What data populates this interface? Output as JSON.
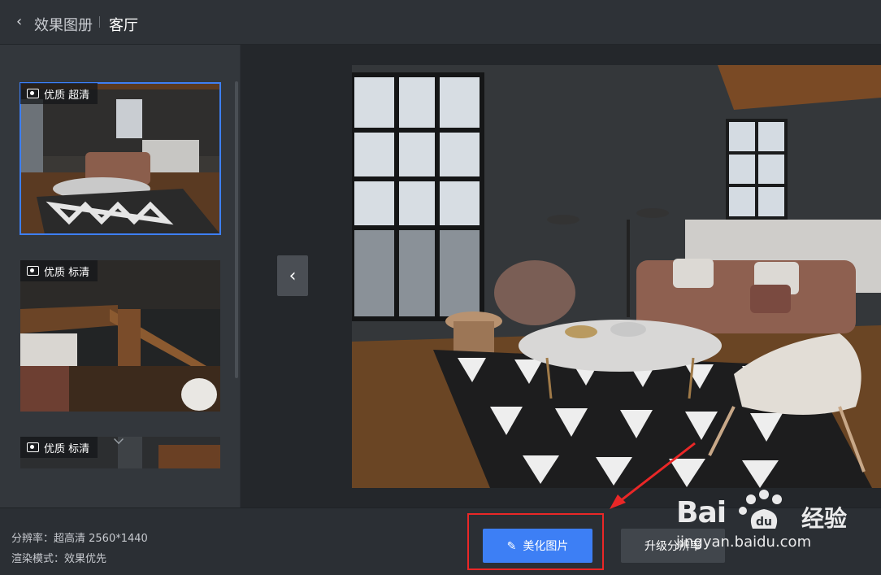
{
  "header": {
    "back_icon": "chevron-left-icon",
    "breadcrumb_album": "效果图册",
    "breadcrumb_room": "客厅"
  },
  "sidebar": {
    "thumbnails": [
      {
        "quality": "优质 超清",
        "icon": "camera-icon",
        "selected": true
      },
      {
        "quality": "优质 标清",
        "icon": "panorama-icon",
        "selected": false
      },
      {
        "quality": "优质 标清",
        "icon": "camera-icon",
        "selected": false
      }
    ],
    "more_icon": "chevron-down-icon"
  },
  "viewer": {
    "prev_icon": "chevron-left-icon"
  },
  "footer": {
    "resolution": "分辨率：超高清 2560*1440",
    "render_mode": "渲染模式：效果优先",
    "beautify_label": "美化图片",
    "beautify_icon": "magic-wand-icon",
    "upgrade_label": "升级分辨率"
  },
  "watermark": {
    "brand": "Bai",
    "brand_suffix": "经验",
    "url": "jingyan.baidu.com"
  },
  "colors": {
    "accent": "#3d7ff5",
    "annotation_red": "#ea2727"
  }
}
